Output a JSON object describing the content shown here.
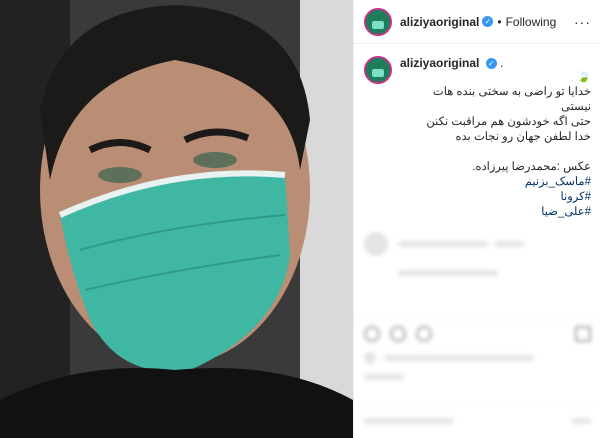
{
  "post": {
    "username": "aliziyaoriginal",
    "verified_icon": "verified-badge-icon",
    "separator": "•",
    "follow_label": "Following",
    "more_icon": "ellipsis-icon",
    "more_glyph": "···",
    "caption": {
      "username": "aliziyaoriginal",
      "suffix": ".",
      "leaf": "🍃",
      "lines": [
        "خدایا تو راضی به سختی بنده هات نیستی",
        "حتی اگه خودشون هم مراقبت نکنن",
        "خدا لطفن جهان رو نجات بده"
      ],
      "credit": "عکس :محمدرضا پیرزاده.",
      "hashtags": [
        "#ماسک_بزنیم",
        "#کرونا",
        "#علی_ضیا"
      ]
    }
  },
  "colors": {
    "link": "#003569",
    "verified": "#3897f0",
    "border": "#efefef",
    "mask": "#3fb7a3"
  }
}
